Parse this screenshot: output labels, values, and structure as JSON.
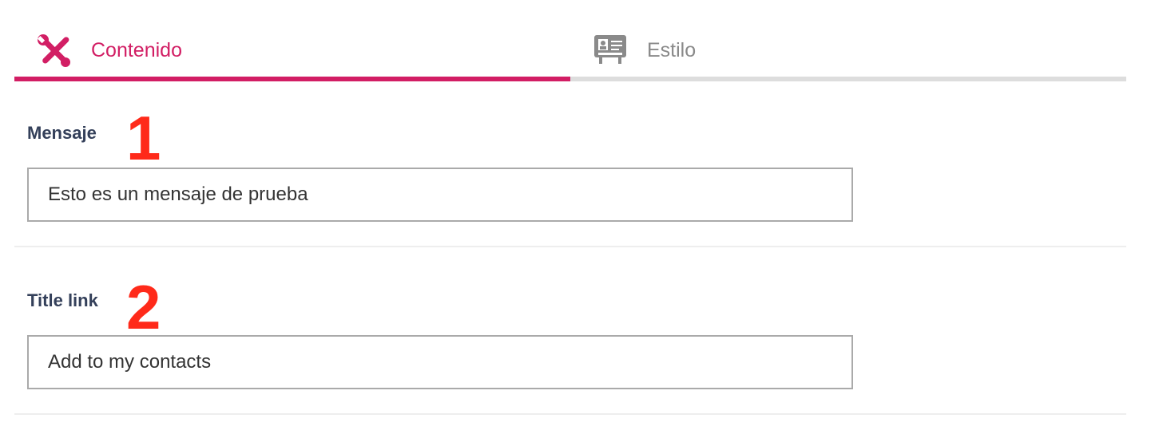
{
  "tabs": [
    {
      "label": "Contenido",
      "icon": "tools-icon",
      "active": true
    },
    {
      "label": "Estilo",
      "icon": "contact-card-icon",
      "active": false
    }
  ],
  "colors": {
    "accent": "#d21e64",
    "inactive_tab": "#8a8a8a",
    "label": "#34405a",
    "marker": "#ff2a1a"
  },
  "fields": [
    {
      "label": "Mensaje",
      "value": "Esto es un mensaje de prueba",
      "marker": "1"
    },
    {
      "label": "Title link",
      "value": "Add to my contacts",
      "marker": "2"
    }
  ]
}
